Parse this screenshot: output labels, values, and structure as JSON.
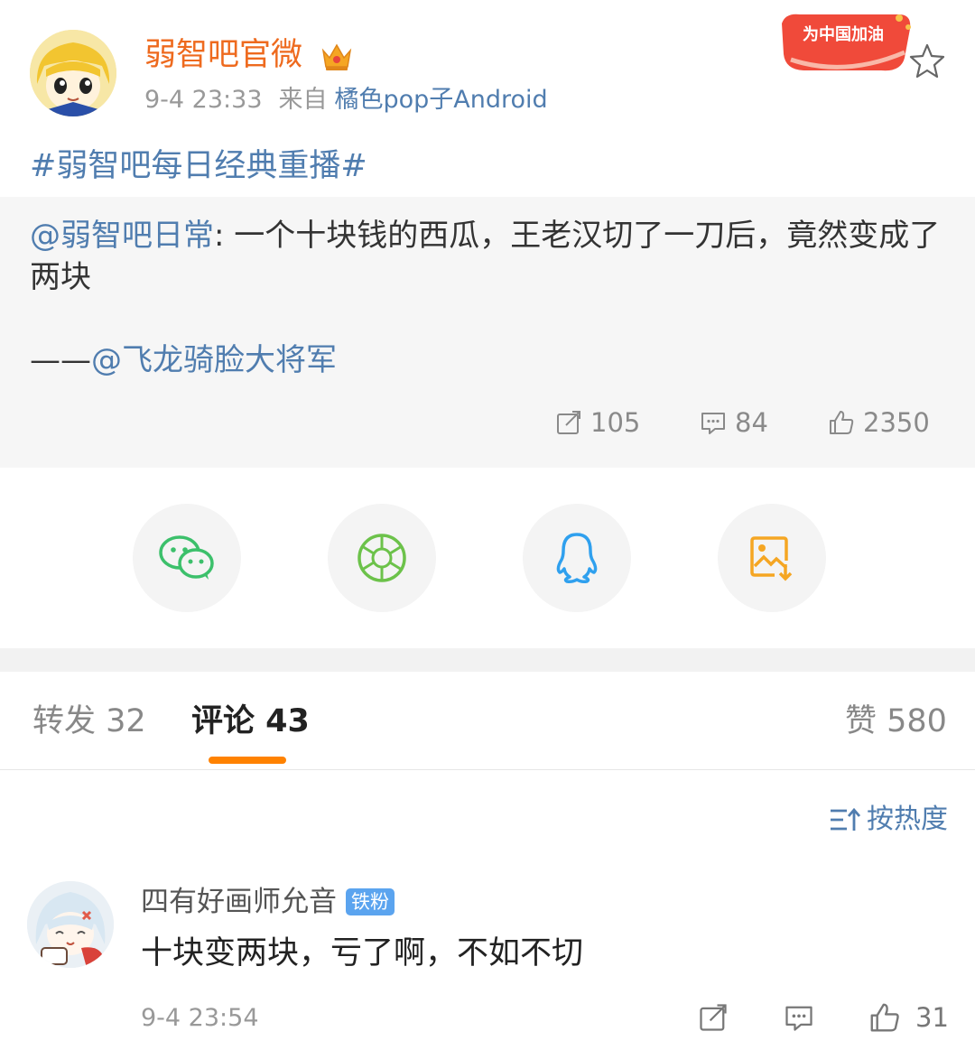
{
  "post": {
    "username": "弱智吧官微",
    "time": "9-4 23:33",
    "from_label": "来自",
    "source": "橘色pop子Android",
    "badge_text": "为中国加油",
    "topic": "#弱智吧每日经典重播#"
  },
  "retweet": {
    "author": "@弱智吧日常",
    "text": ": 一个十块钱的西瓜，王老汉切了一刀后，竟然变成了两块",
    "sig_prefix": "——",
    "sig_author": "@飞龙骑脸大将军",
    "reposts": "105",
    "comments": "84",
    "likes": "2350"
  },
  "share": {
    "items": [
      "wechat-icon",
      "moments-icon",
      "qq-icon",
      "save-image-icon"
    ],
    "colors": {
      "wechat": "#3cc06b",
      "moments": "#6cc24a",
      "qq": "#2fa0ee",
      "save": "#f5a623"
    }
  },
  "tabs": {
    "repost_label": "转发 32",
    "comment_label": "评论 43",
    "like_label": "赞 580"
  },
  "sort": {
    "label": "按热度"
  },
  "comment": {
    "name": "四有好画师允音",
    "badge": "铁粉",
    "text": "十块变两块，亏了啊，不如不切",
    "time": "9-4 23:54",
    "likes": "31"
  },
  "colors": {
    "accent": "#ff8200",
    "username": "#ee6a1e",
    "link": "#507daf"
  }
}
